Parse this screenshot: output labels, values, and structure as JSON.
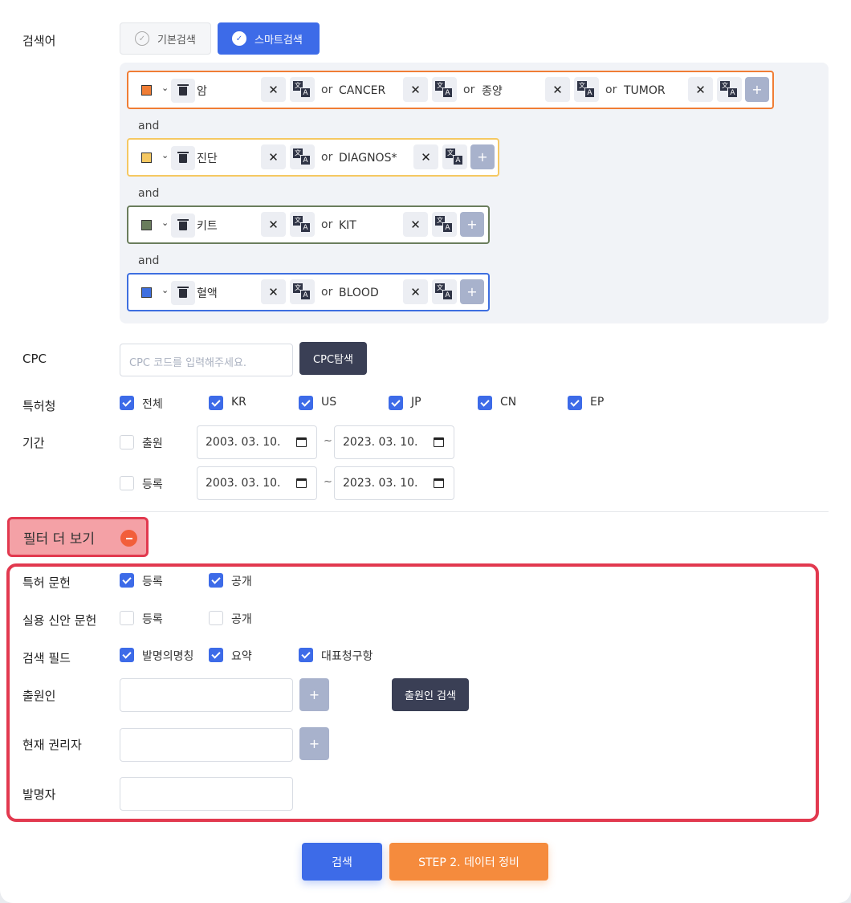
{
  "labels": {
    "keyword": "검색어",
    "cpc": "CPC",
    "office": "특허청",
    "period": "기간",
    "patent_doc": "특허 문헌",
    "utility_doc": "실용 신안 문헌",
    "search_field": "검색 필드",
    "applicant": "출원인",
    "current_owner": "현재 권리자",
    "inventor": "발명자"
  },
  "mode_tabs": {
    "basic": "기본검색",
    "smart": "스마트검색",
    "active": "smart"
  },
  "connector": "and",
  "or_label": "or",
  "term_groups": [
    {
      "color": "#f07d35",
      "border": "#f07d35",
      "terms": [
        "암",
        "CANCER",
        "종양",
        "TUMOR"
      ]
    },
    {
      "color": "#f5c862",
      "border": "#f5c862",
      "terms": [
        "진단",
        "DIAGNOS*"
      ]
    },
    {
      "color": "#6a7d5c",
      "border": "#6a7d5c",
      "terms": [
        "키트",
        "KIT"
      ]
    },
    {
      "color": "#3e6fe0",
      "border": "#3e6fe0",
      "terms": [
        "혈액",
        "BLOOD"
      ]
    }
  ],
  "icons": {
    "clear": "close-icon",
    "translate": "translate-icon",
    "delete": "trash-icon",
    "add": "plus-icon",
    "toggle": "chevron-down-icon",
    "calendar": "calendar-icon"
  },
  "translate_glyphs": {
    "source": "文",
    "target": "A"
  },
  "glyphs": {
    "x": "✕",
    "plus": "+",
    "caret": "⌄",
    "tilde": "~"
  },
  "cpc": {
    "placeholder": "CPC 코드를 입력해주세요.",
    "explore_button": "CPC탐색"
  },
  "offices": [
    {
      "label": "전체",
      "checked": true
    },
    {
      "label": "KR",
      "checked": true
    },
    {
      "label": "US",
      "checked": true
    },
    {
      "label": "JP",
      "checked": true
    },
    {
      "label": "CN",
      "checked": true
    },
    {
      "label": "EP",
      "checked": true
    }
  ],
  "period": {
    "rows": [
      {
        "label": "출원",
        "checked": false,
        "from": "2003. 03. 10.",
        "to": "2023. 03. 10."
      },
      {
        "label": "등록",
        "checked": false,
        "from": "2003. 03. 10.",
        "to": "2023. 03. 10."
      }
    ]
  },
  "filter_toggle": "필터 더 보기",
  "patent_doc_options": [
    {
      "label": "등록",
      "checked": true
    },
    {
      "label": "공개",
      "checked": true
    }
  ],
  "utility_doc_options": [
    {
      "label": "등록",
      "checked": false
    },
    {
      "label": "공개",
      "checked": false
    }
  ],
  "search_field_options": [
    {
      "label": "발명의명칭",
      "checked": true
    },
    {
      "label": "요약",
      "checked": true
    },
    {
      "label": "대표청구항",
      "checked": true
    }
  ],
  "applicant_search_button": "출원인 검색",
  "actions": {
    "search": "검색",
    "next_step": "STEP 2. 데이터 정비"
  },
  "colors": {
    "primary": "#3d6be8",
    "accent": "#f58b3d",
    "highlight": "#e2394f",
    "dark": "#3a3f55"
  }
}
